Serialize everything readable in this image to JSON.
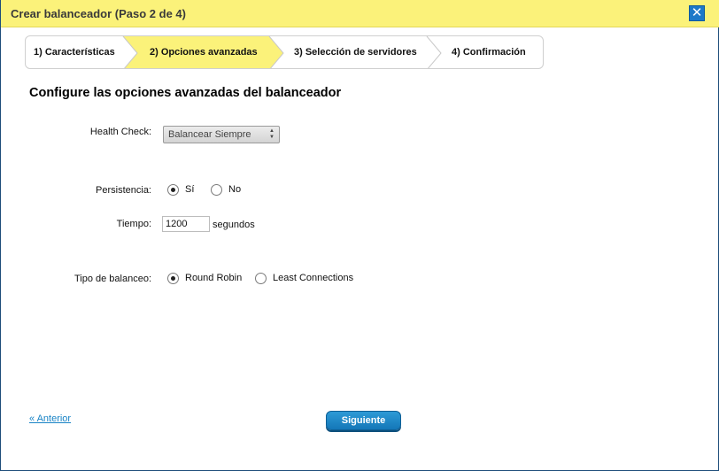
{
  "dialog": {
    "title": "Crear balanceador (Paso 2 de 4)",
    "close_symbol": "✕"
  },
  "steps": [
    {
      "label": "1) Características",
      "active": false
    },
    {
      "label": "2) Opciones avanzadas",
      "active": true
    },
    {
      "label": "3) Selección de servidores",
      "active": false
    },
    {
      "label": "4) Confirmación",
      "active": false
    }
  ],
  "heading": "Configure las opciones avanzadas del balanceador",
  "health_check": {
    "label": "Health Check:",
    "selected": "Balancear Siempre"
  },
  "persistence": {
    "label": "Persistencia:",
    "options": [
      {
        "label": "Sí",
        "checked": true
      },
      {
        "label": "No",
        "checked": false
      }
    ]
  },
  "time": {
    "label": "Tiempo:",
    "value": "1200",
    "unit": "segundos"
  },
  "balance_type": {
    "label": "Tipo de balanceo:",
    "options": [
      {
        "label": "Round Robin",
        "checked": true
      },
      {
        "label": "Least Connections",
        "checked": false
      }
    ]
  },
  "footer": {
    "prev_label": "« Anterior",
    "next_label": "Siguiente"
  },
  "colors": {
    "titlebar": "#fbf27a",
    "active_step": "#fbf27a",
    "accent": "#1d79c8",
    "link": "#1a84c6"
  }
}
